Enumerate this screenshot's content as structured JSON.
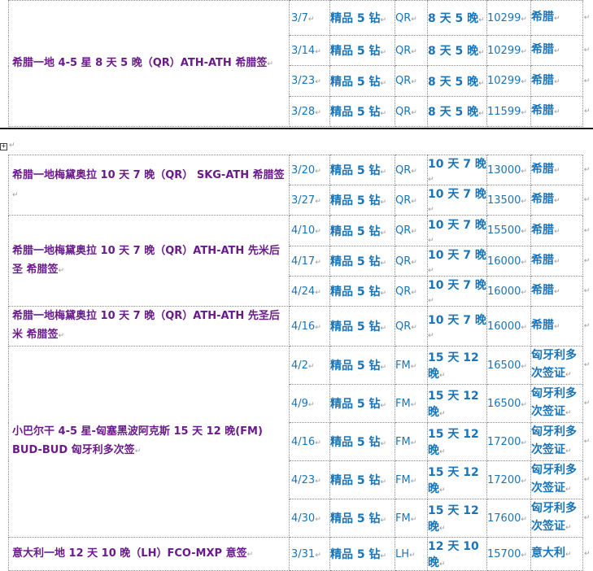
{
  "mark": "↵",
  "tables": [
    {
      "groups": [
        {
          "name": "希腊一地 4-5 星 8 天 5 晚（QR）ATH-ATH 希腊签",
          "rows": [
            {
              "date": "3/7",
              "grade": "精品 5 钻",
              "airline": "QR",
              "duration": "8 天 5 晚",
              "price": "10299",
              "visa": "希腊"
            },
            {
              "date": "3/14",
              "grade": "精品 5 钻",
              "airline": "QR",
              "duration": "8 天 5 晚",
              "price": "10299",
              "visa": "希腊"
            },
            {
              "date": "3/23",
              "grade": "精品 5 钻",
              "airline": "QR",
              "duration": "8 天 5 晚",
              "price": "10299",
              "visa": "希腊"
            },
            {
              "date": "3/28",
              "grade": "精品 5 钻",
              "airline": "QR",
              "duration": "8 天 5 晚",
              "price": "11599",
              "visa": "希腊"
            }
          ]
        }
      ]
    },
    {
      "groups": [
        {
          "name": "希腊一地梅黛奥拉 10 天 7 晚（QR） SKG-ATH 希腊签",
          "rows": [
            {
              "date": "3/20",
              "grade": "精品 5 钻",
              "airline": "QR",
              "duration": "10 天 7 晚",
              "price": "13000",
              "visa": "希腊"
            },
            {
              "date": "3/27",
              "grade": "精品 5 钻",
              "airline": "QR",
              "duration": "10 天 7 晚",
              "price": "13500",
              "visa": "希腊"
            }
          ]
        },
        {
          "name": "希腊一地梅黛奥拉 10 天 7 晚（QR）ATH-ATH 先米后圣 希腊签",
          "rows": [
            {
              "date": "4/10",
              "grade": "精品 5 钻",
              "airline": "QR",
              "duration": "10 天 7 晚",
              "price": "15500",
              "visa": "希腊"
            },
            {
              "date": "4/17",
              "grade": "精品 5 钻",
              "airline": "QR",
              "duration": "10 天 7 晚",
              "price": "16000",
              "visa": "希腊"
            },
            {
              "date": "4/24",
              "grade": "精品 5 钻",
              "airline": "QR",
              "duration": "10 天 7 晚",
              "price": "16000",
              "visa": "希腊"
            }
          ]
        },
        {
          "name": "希腊一地梅黛奥拉 10 天 7 晚（QR）ATH-ATH 先圣后米 希腊签",
          "rows": [
            {
              "date": "4/16",
              "grade": "精品 5 钻",
              "airline": "QR",
              "duration": "10 天 7 晚",
              "price": "16000",
              "visa": "希腊"
            }
          ]
        },
        {
          "name": "小巴尔干 4-5 星-匈塞黑波阿克斯 15 天 12 晚(FM) BUD-BUD 匈牙利多次签",
          "rows": [
            {
              "date": "4/2",
              "grade": "精品 5 钻",
              "airline": "FM",
              "duration": "15 天 12 晚",
              "price": "16500",
              "visa": "匈牙利多次签证"
            },
            {
              "date": "4/9",
              "grade": "精品 5 钻",
              "airline": "FM",
              "duration": "15 天 12 晚",
              "price": "16500",
              "visa": "匈牙利多次签证"
            },
            {
              "date": "4/16",
              "grade": "精品 5 钻",
              "airline": "FM",
              "duration": "15 天 12 晚",
              "price": "17200",
              "visa": "匈牙利多次签证"
            },
            {
              "date": "4/23",
              "grade": "精品 5 钻",
              "airline": "FM",
              "duration": "15 天 12 晚",
              "price": "17200",
              "visa": "匈牙利多次签证"
            },
            {
              "date": "4/30",
              "grade": "精品 5 钻",
              "airline": "FM",
              "duration": "15 天 12 晚",
              "price": "17600",
              "visa": "匈牙利多次签证"
            }
          ]
        },
        {
          "name": "意大利一地 12 天 10 晚（LH）FCO-MXP 意签",
          "rows": [
            {
              "date": "3/31",
              "grade": "精品 5 钻",
              "airline": "LH",
              "duration": "12 天 10 晚",
              "price": "15700",
              "visa": "意大利"
            }
          ]
        }
      ]
    }
  ]
}
